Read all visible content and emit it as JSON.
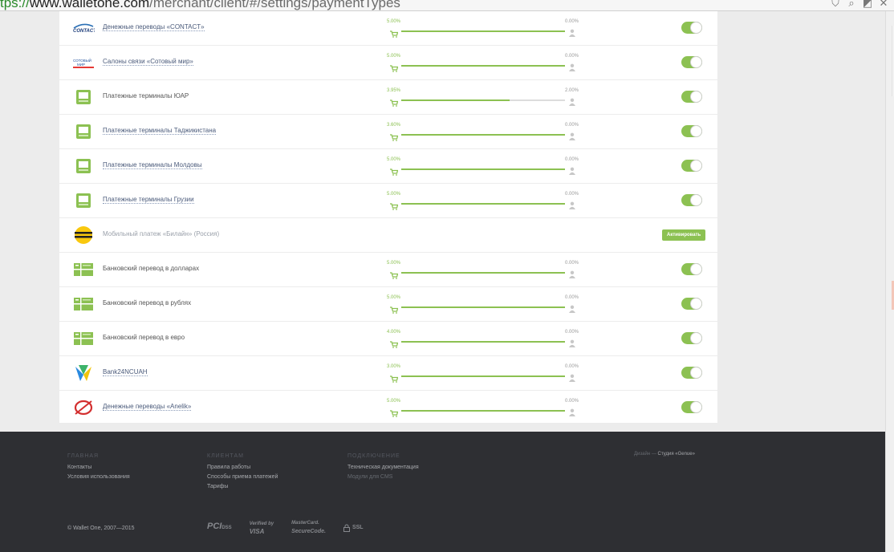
{
  "browser": {
    "url_scheme": "tps://",
    "url_host": "www.walletone.com",
    "url_path": "/merchant/client/#/settings/paymentTypes"
  },
  "payment_methods": [
    {
      "name": "Денежные переводы «CONTACT»",
      "fee_left": "5.00%",
      "fee_right": "0.00%",
      "fill": 1.0,
      "status": "on",
      "logo": "contact-logo",
      "style": "link"
    },
    {
      "name": "Салоны связи «Сотовый мир»",
      "fee_left": "5.00%",
      "fee_right": "0.00%",
      "fill": 1.0,
      "status": "on",
      "logo": "sotovy-mir-logo",
      "style": "link"
    },
    {
      "name": "Платежные терминалы ЮАР",
      "fee_left": "3.95%",
      "fee_right": "2.00%",
      "fill": 0.66,
      "status": "on",
      "logo": "terminal-icon",
      "style": "plain"
    },
    {
      "name": "Платежные терминалы Таджикистана",
      "fee_left": "3.60%",
      "fee_right": "0.00%",
      "fill": 1.0,
      "status": "on",
      "logo": "terminal-icon",
      "style": "link"
    },
    {
      "name": "Платежные терминалы Молдовы",
      "fee_left": "5.00%",
      "fee_right": "0.00%",
      "fill": 1.0,
      "status": "on",
      "logo": "terminal-icon",
      "style": "link"
    },
    {
      "name": "Платежные терминалы Грузии",
      "fee_left": "5.00%",
      "fee_right": "0.00%",
      "fill": 1.0,
      "status": "on",
      "logo": "terminal-icon",
      "style": "link"
    },
    {
      "name": "Мобильный платеж «Билайн» (Россия)",
      "status": "inactive",
      "activate_label": "Активировать",
      "logo": "beeline-logo",
      "style": "dim"
    },
    {
      "name": "Банковский перевод в долларах",
      "fee_left": "5.00%",
      "fee_right": "0.00%",
      "fill": 1.0,
      "status": "on",
      "logo": "bank-transfer-icon",
      "style": "plain"
    },
    {
      "name": "Банковский перевод в рублях",
      "fee_left": "5.00%",
      "fee_right": "0.00%",
      "fill": 1.0,
      "status": "on",
      "logo": "bank-transfer-icon",
      "style": "plain"
    },
    {
      "name": "Банковский перевод в евро",
      "fee_left": "4.00%",
      "fee_right": "0.00%",
      "fill": 1.0,
      "status": "on",
      "logo": "bank-transfer-icon",
      "style": "plain"
    },
    {
      "name": "Bank24NCUAH",
      "fee_left": "3.00%",
      "fee_right": "0.00%",
      "fill": 1.0,
      "status": "on",
      "logo": "bank24-logo",
      "style": "link"
    },
    {
      "name": "Денежные переводы «Anelik»",
      "fee_left": "5.00%",
      "fee_right": "0.00%",
      "fill": 1.0,
      "status": "on",
      "logo": "anelik-logo",
      "style": "link"
    }
  ],
  "footer": {
    "columns": [
      {
        "heading": "Главная",
        "links": [
          {
            "label": "Контакты"
          },
          {
            "label": "Условия использования"
          }
        ]
      },
      {
        "heading": "Клиентам",
        "links": [
          {
            "label": "Правила работы"
          },
          {
            "label": "Способы приема платежей"
          },
          {
            "label": "Тарифы"
          }
        ]
      },
      {
        "heading": "Подключение",
        "links": [
          {
            "label": "Техническая документация"
          },
          {
            "label": "Модули для CMS",
            "dim": true
          }
        ]
      }
    ],
    "design_prefix": "Дизайн —",
    "design_studio": "Студия «Genue»",
    "copyright": "© Wallet One, 2007—2015",
    "badges": {
      "pci": "PCI",
      "pci_sub": "DSS",
      "visa_top": "Verified by",
      "visa_main": "VISA",
      "mc_top": "MasterCard.",
      "mc_main": "SecureCode.",
      "ssl": "SSL"
    }
  },
  "colors": {
    "accent": "#8cc152",
    "footer_bg": "#2e2f33",
    "link": "#4a5a7a"
  }
}
